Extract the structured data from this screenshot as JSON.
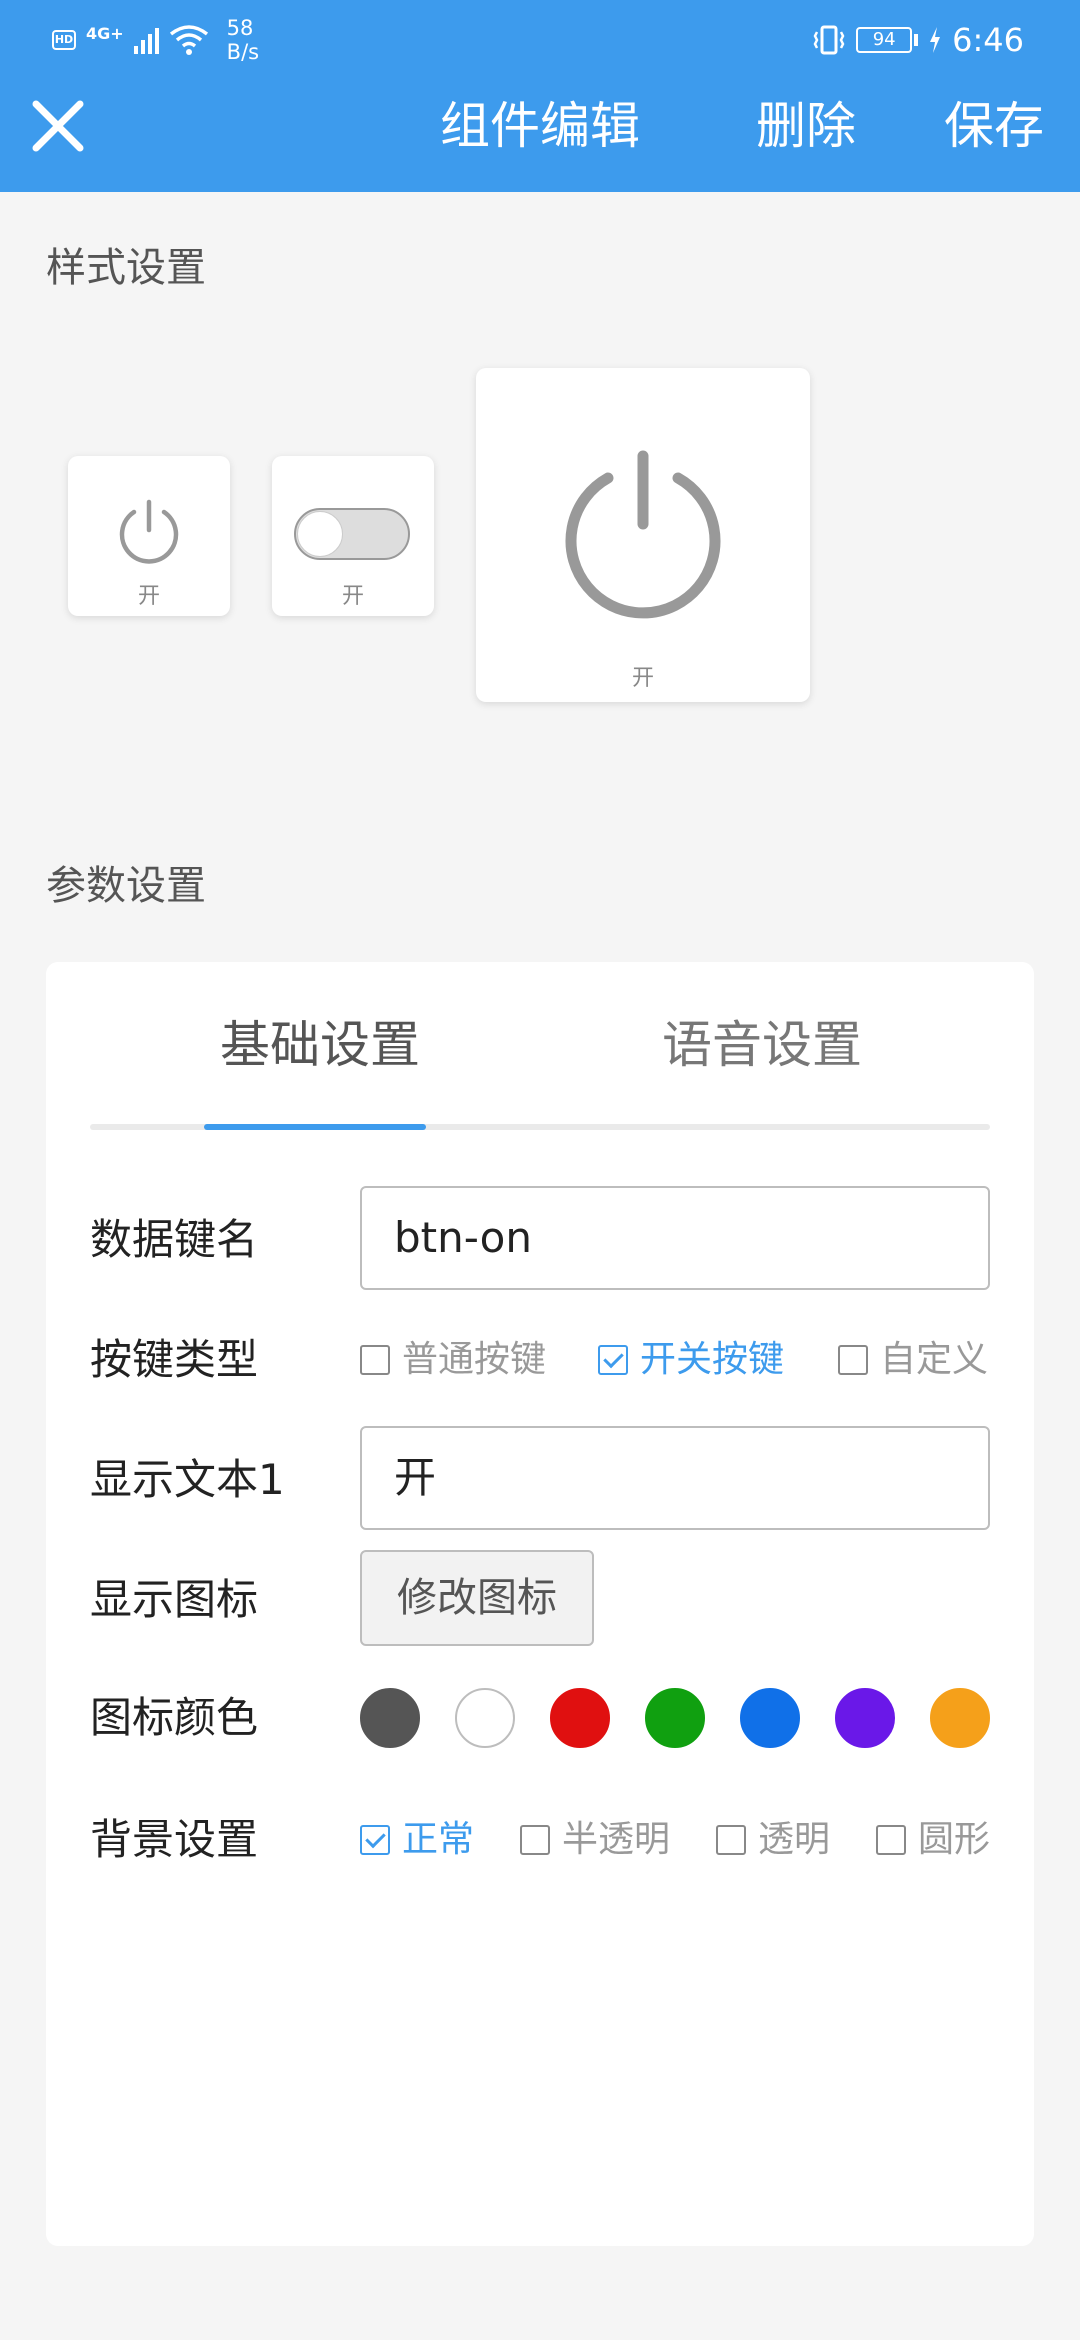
{
  "status_bar": {
    "hd": "HD",
    "network": "4G+",
    "speed_value": "58",
    "speed_unit": "B/s",
    "battery": "94",
    "time": "6:46"
  },
  "header": {
    "title": "组件编辑",
    "delete_label": "删除",
    "save_label": "保存"
  },
  "style_section": {
    "title": "样式设置",
    "cards": [
      {
        "label": "开"
      },
      {
        "label": "开"
      },
      {
        "label": "开"
      }
    ]
  },
  "params_section": {
    "title": "参数设置",
    "tabs": [
      {
        "label": "基础设置",
        "active": true
      },
      {
        "label": "语音设置",
        "active": false
      }
    ],
    "data_key": {
      "label": "数据键名",
      "value": "btn-on"
    },
    "key_type": {
      "label": "按键类型",
      "options": [
        {
          "label": "普通按键",
          "checked": false
        },
        {
          "label": "开关按键",
          "checked": true
        },
        {
          "label": "自定义",
          "checked": false
        }
      ]
    },
    "display_text": {
      "label": "显示文本1",
      "value": "开"
    },
    "display_icon": {
      "label": "显示图标",
      "button_label": "修改图标"
    },
    "icon_color": {
      "label": "图标颜色",
      "colors": [
        "#555555",
        "#ffffff",
        "#e01010",
        "#10a010",
        "#1070e8",
        "#6a18e8",
        "#f5a01a"
      ]
    },
    "background": {
      "label": "背景设置",
      "options": [
        {
          "label": "正常",
          "checked": true
        },
        {
          "label": "半透明",
          "checked": false
        },
        {
          "label": "透明",
          "checked": false
        },
        {
          "label": "圆形",
          "checked": false
        }
      ]
    }
  },
  "colors": {
    "accent": "#3d9bed",
    "background": "#f5f5f5"
  }
}
